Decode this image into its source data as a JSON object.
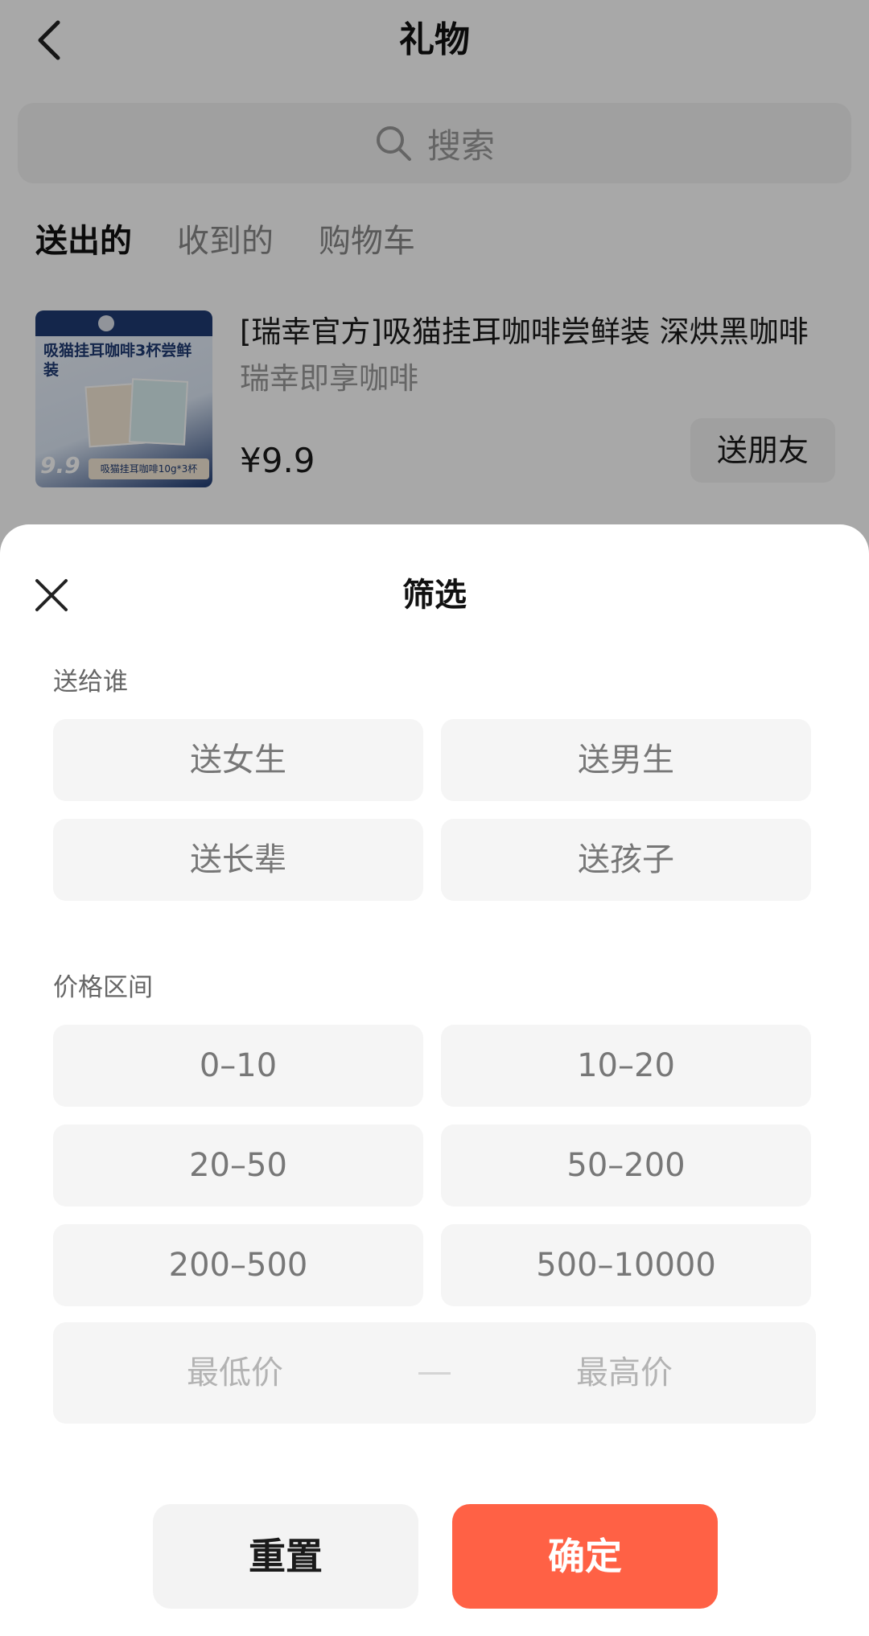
{
  "header": {
    "title": "礼物"
  },
  "search": {
    "placeholder": "搜索"
  },
  "tabs": [
    {
      "label": "送出的",
      "active": true
    },
    {
      "label": "收到的",
      "active": false
    },
    {
      "label": "购物车",
      "active": false
    }
  ],
  "product": {
    "name": "[瑞幸官方]吸猫挂耳咖啡尝鲜装 深烘黑咖啡",
    "shop": "瑞幸即享咖啡",
    "price": "¥9.9",
    "action": "送朋友",
    "image": {
      "headline": "吸猫挂耳咖啡3杯尝鲜装",
      "badge_price": "9.9",
      "strip_text": "吸猫挂耳咖啡10g*3杯"
    }
  },
  "filter": {
    "title": "筛选",
    "recipient": {
      "label": "送给谁",
      "options": [
        "送女生",
        "送男生",
        "送长辈",
        "送孩子"
      ]
    },
    "price": {
      "label": "价格区间",
      "options": [
        "0–10",
        "10–20",
        "20–50",
        "50–200",
        "200–500",
        "500–10000"
      ],
      "min_placeholder": "最低价",
      "max_placeholder": "最高价"
    },
    "reset_label": "重置",
    "confirm_label": "确定"
  },
  "colors": {
    "accent": "#ff6145",
    "chip_bg": "#f5f5f5",
    "overlay": "rgba(0,0,0,0.34)"
  }
}
